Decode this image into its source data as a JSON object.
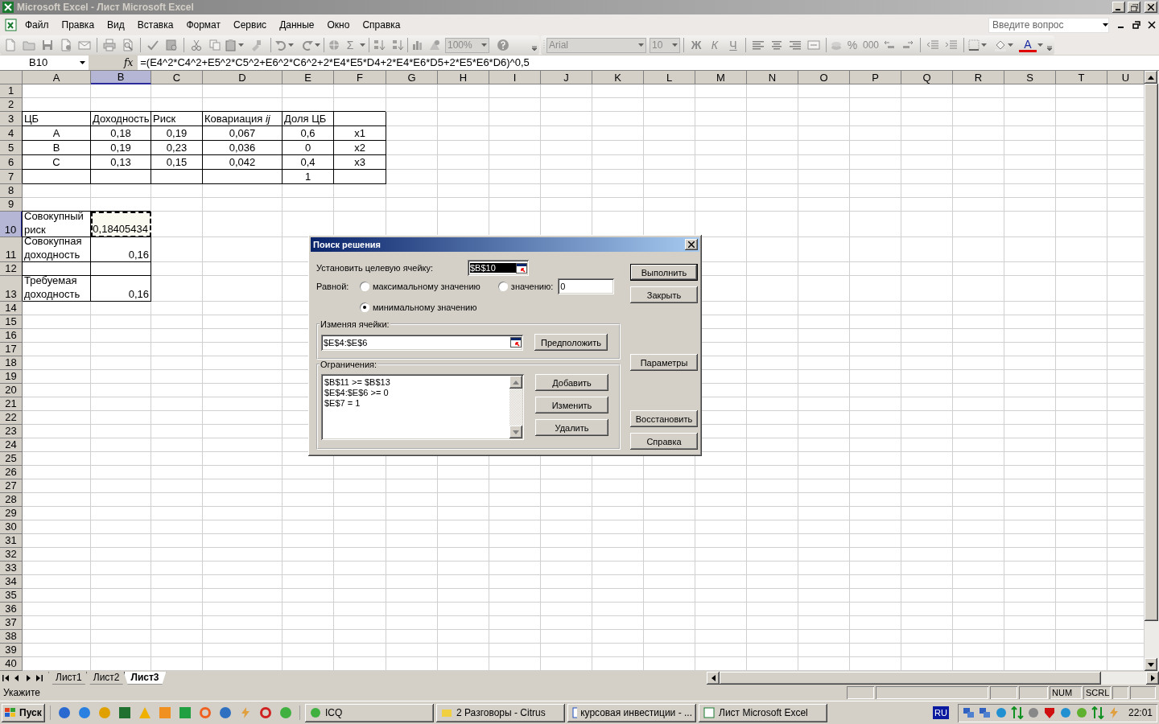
{
  "window": {
    "title": "Microsoft Excel - Лист Microsoft Excel"
  },
  "menu": [
    "Файл",
    "Правка",
    "Вид",
    "Вставка",
    "Формат",
    "Сервис",
    "Данные",
    "Окно",
    "Справка"
  ],
  "help_box": {
    "placeholder": "Введите вопрос"
  },
  "standard_toolbar": {
    "disabled": true,
    "sum": "Σ",
    "zoom": "100%"
  },
  "formatting_toolbar": {
    "disabled": true,
    "font": "Arial",
    "size": "10",
    "style_buttons": [
      "Ж",
      "К",
      "Ч"
    ],
    "percent": "%",
    "thousands": "000",
    "font_color": "A"
  },
  "formula_bar": {
    "name_box": "B10",
    "fx": "fx",
    "formula": "=(E4^2*C4^2+E5^2*C5^2+E6^2*C6^2+2*E4*E5*D4+2*E4*E6*D5+2*E5*E6*D6)^0,5"
  },
  "sheet": {
    "columns": [
      {
        "label": "A",
        "selected": false
      },
      {
        "label": "B",
        "selected": true
      },
      {
        "label": "C",
        "selected": false
      },
      {
        "label": "D",
        "selected": false
      },
      {
        "label": "E",
        "selected": false
      },
      {
        "label": "F",
        "selected": false
      },
      {
        "label": "G",
        "selected": false
      },
      {
        "label": "H",
        "selected": false
      },
      {
        "label": "I",
        "selected": false
      },
      {
        "label": "J",
        "selected": false
      },
      {
        "label": "K",
        "selected": false
      },
      {
        "label": "L",
        "selected": false
      },
      {
        "label": "M",
        "selected": false
      },
      {
        "label": "N",
        "selected": false
      },
      {
        "label": "O",
        "selected": false
      },
      {
        "label": "P",
        "selected": false
      },
      {
        "label": "Q",
        "selected": false
      },
      {
        "label": "R",
        "selected": false
      },
      {
        "label": "S",
        "selected": false
      },
      {
        "label": "T",
        "selected": false
      },
      {
        "label": "U",
        "selected": false
      }
    ],
    "rows": [
      {
        "label": "1",
        "selected": false
      },
      {
        "label": "2",
        "selected": false
      },
      {
        "label": "3",
        "selected": false,
        "cells": [
          {
            "text": "ЦБ",
            "kind": "heading",
            "bordered": true,
            "selected": false
          },
          {
            "text": "Доходность",
            "kind": "heading",
            "bordered": true,
            "selected": false
          },
          {
            "text": "Риск",
            "kind": "heading",
            "bordered": true,
            "selected": false
          },
          {
            "text": "Ковариация *ij*",
            "kind": "heading",
            "bordered": true,
            "selected": false
          },
          {
            "text": "Доля ЦБ",
            "kind": "heading",
            "bordered": true,
            "selected": false
          },
          {
            "bordered": true,
            "selected": false
          }
        ]
      },
      {
        "label": "4",
        "selected": false,
        "cells": [
          {
            "text": "A",
            "kind": "entry",
            "bordered": true,
            "selected": false
          },
          {
            "text": "0,18",
            "kind": "entry",
            "bordered": true,
            "selected": false
          },
          {
            "text": "0,19",
            "kind": "entry",
            "bordered": true,
            "selected": false
          },
          {
            "text": "0,067",
            "kind": "entry",
            "bordered": true,
            "selected": false
          },
          {
            "text": "0,6",
            "kind": "entry",
            "bordered": true,
            "selected": false
          },
          {
            "text": "x1",
            "kind": "entry",
            "bordered": true,
            "selected": false
          }
        ]
      },
      {
        "label": "5",
        "selected": false,
        "cells": [
          {
            "text": "B",
            "kind": "entry",
            "bordered": true,
            "selected": false
          },
          {
            "text": "0,19",
            "kind": "entry",
            "bordered": true,
            "selected": false
          },
          {
            "text": "0,23",
            "kind": "entry",
            "bordered": true,
            "selected": false
          },
          {
            "text": "0,036",
            "kind": "entry",
            "bordered": true,
            "selected": false
          },
          {
            "text": "0",
            "kind": "entry",
            "bordered": true,
            "selected": false
          },
          {
            "text": "x2",
            "kind": "entry",
            "bordered": true,
            "selected": false
          }
        ]
      },
      {
        "label": "6",
        "selected": false,
        "cells": [
          {
            "text": "C",
            "kind": "entry",
            "bordered": true,
            "selected": false
          },
          {
            "text": "0,13",
            "kind": "entry",
            "bordered": true,
            "selected": false
          },
          {
            "text": "0,15",
            "kind": "entry",
            "bordered": true,
            "selected": false
          },
          {
            "text": "0,042",
            "kind": "entry",
            "bordered": true,
            "selected": false
          },
          {
            "text": "0,4",
            "kind": "entry",
            "bordered": true,
            "selected": false
          },
          {
            "text": "x3",
            "kind": "entry",
            "bordered": true,
            "selected": false
          }
        ]
      },
      {
        "label": "7",
        "selected": false,
        "cells": [
          {
            "bordered": true,
            "selected": false
          },
          {
            "bordered": true,
            "selected": false
          },
          {
            "bordered": true,
            "selected": false
          },
          {
            "bordered": true,
            "selected": false
          },
          {
            "text": "1",
            "kind": "entry",
            "bordered": true,
            "selected": false
          },
          {
            "bordered": true,
            "selected": false
          }
        ]
      },
      {
        "label": "8",
        "selected": false
      },
      {
        "label": "9",
        "selected": false
      },
      {
        "label": "10",
        "selected": true,
        "cells": [
          {
            "text": "Совокупный риск",
            "kind": "heading",
            "bordered": true,
            "selected": false
          },
          {
            "text": "0,18405434",
            "kind": "value",
            "bordered": true,
            "selected": true
          }
        ]
      },
      {
        "label": "11",
        "selected": false,
        "cells": [
          {
            "text": "Совокупная доходность",
            "kind": "heading",
            "bordered": true,
            "selected": false
          },
          {
            "text": "0,16",
            "kind": "value",
            "bordered": true,
            "selected": false
          }
        ]
      },
      {
        "label": "12",
        "selected": false,
        "cells": [
          {
            "bordered": true,
            "selected": false
          },
          {
            "bordered": true,
            "selected": false
          }
        ]
      },
      {
        "label": "13",
        "selected": false,
        "cells": [
          {
            "text": "Требуемая доходность",
            "kind": "heading",
            "bordered": true,
            "selected": false
          },
          {
            "text": "0,16",
            "kind": "value",
            "bordered": true,
            "selected": false
          }
        ]
      },
      {
        "label": "14",
        "selected": false
      },
      {
        "label": "15",
        "selected": false
      },
      {
        "label": "16",
        "selected": false
      },
      {
        "label": "17",
        "selected": false
      },
      {
        "label": "18",
        "selected": false
      },
      {
        "label": "19",
        "selected": false
      },
      {
        "label": "20",
        "selected": false
      },
      {
        "label": "21",
        "selected": false
      },
      {
        "label": "22",
        "selected": false
      },
      {
        "label": "23",
        "selected": false
      },
      {
        "label": "24",
        "selected": false
      },
      {
        "label": "25",
        "selected": false
      },
      {
        "label": "26",
        "selected": false
      },
      {
        "label": "27",
        "selected": false
      },
      {
        "label": "28",
        "selected": false
      },
      {
        "label": "29",
        "selected": false
      },
      {
        "label": "30",
        "selected": false
      },
      {
        "label": "31",
        "selected": false
      },
      {
        "label": "32",
        "selected": false
      },
      {
        "label": "33",
        "selected": false
      },
      {
        "label": "34",
        "selected": false
      },
      {
        "label": "35",
        "selected": false
      },
      {
        "label": "36",
        "selected": false
      },
      {
        "label": "37",
        "selected": false
      },
      {
        "label": "38",
        "selected": false
      },
      {
        "label": "39",
        "selected": false
      },
      {
        "label": "40",
        "selected": false
      }
    ]
  },
  "dialog": {
    "title": "Поиск решения",
    "target_label": "Установить целевую ячейку:",
    "target": {
      "value": "$B$10",
      "text_selected": true
    },
    "equal_label": "Равной:",
    "options": [
      {
        "label": "максимальному значению",
        "selected": false
      },
      {
        "label": "значению:",
        "selected": false
      },
      {
        "label": "минимальному значению",
        "selected": true
      }
    ],
    "value_field": {
      "value": "0"
    },
    "changing_label": "Изменяя ячейки:",
    "changing_field": {
      "value": "$E$4:$E$6"
    },
    "guess_button": "Предположить",
    "constraints_label": "Ограничения:",
    "constraints": [
      "$B$11 >= $B$13",
      "$E$4:$E$6 >= 0",
      "$E$7 = 1"
    ],
    "constraint_buttons": [
      "Добавить",
      "Изменить",
      "Удалить"
    ],
    "side_buttons": [
      {
        "label": "Выполнить",
        "default": true
      },
      {
        "label": "Закрыть",
        "default": false
      },
      {
        "label": "Параметры",
        "default": false
      },
      {
        "label": "Восстановить",
        "default": false
      },
      {
        "label": "Справка",
        "default": false
      }
    ]
  },
  "sheet_tabs": [
    {
      "label": "Лист1",
      "selected": false
    },
    {
      "label": "Лист2",
      "selected": false
    },
    {
      "label": "Лист3",
      "selected": true
    }
  ],
  "status_bar": {
    "message": "Укажите",
    "indicators": [
      "NUM",
      "SCRL"
    ]
  },
  "taskbar": {
    "start": "Пуск",
    "tasks": [
      {
        "label": "ICQ",
        "selected": false
      },
      {
        "label": "2 Разговоры - Citrus",
        "selected": false
      },
      {
        "label": "курсовая инвестиции - ...",
        "selected": false
      },
      {
        "label": "Лист Microsoft Excel",
        "selected": false
      }
    ],
    "language": "RU",
    "clock": "22:01"
  }
}
